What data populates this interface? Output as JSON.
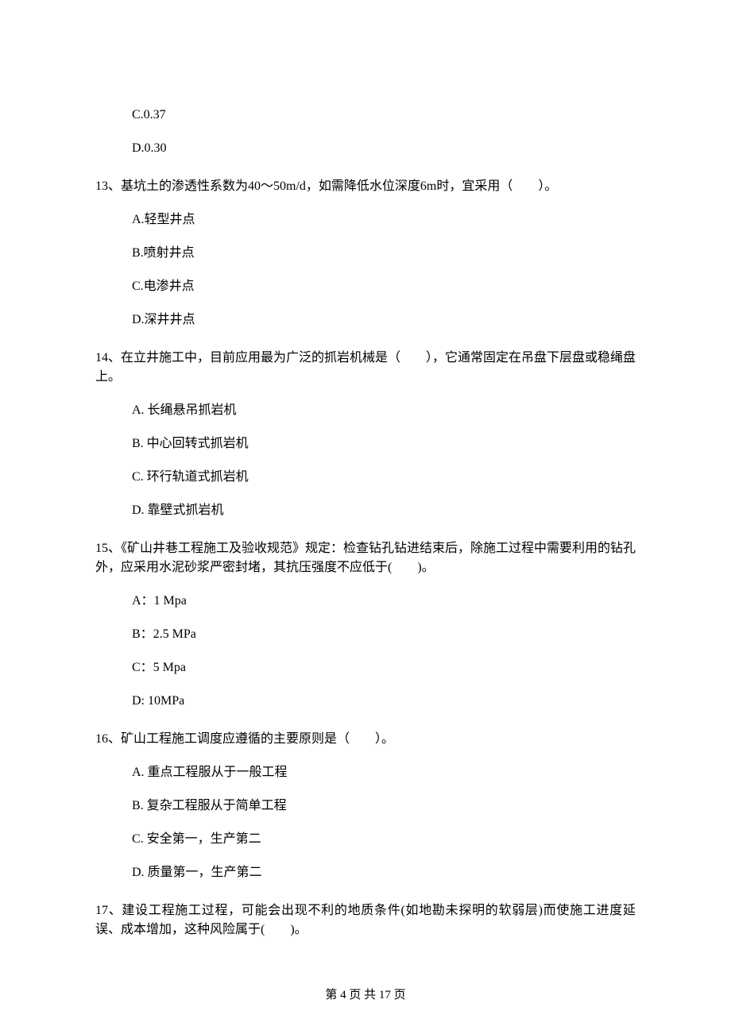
{
  "q12": {
    "optC": "C.0.37",
    "optD": "D.0.30"
  },
  "q13": {
    "stem": "13、基坑土的渗透性系数为40～50m/d，如需降低水位深度6m时，宜采用（　　）。",
    "optA": "A.轻型井点",
    "optB": "B.喷射井点",
    "optC": "C.电渗井点",
    "optD": "D.深井井点"
  },
  "q14": {
    "stem": "14、在立井施工中，目前应用最为广泛的抓岩机械是（　　），它通常固定在吊盘下层盘或稳绳盘上。",
    "optA": "A. 长绳悬吊抓岩机",
    "optB": "B. 中心回转式抓岩机",
    "optC": "C. 环行轨道式抓岩机",
    "optD": "D. 靠壁式抓岩机"
  },
  "q15": {
    "stem": "15、《矿山井巷工程施工及验收规范》规定：检查钻孔钻进结束后，除施工过程中需要利用的钻孔外，应采用水泥砂浆严密封堵，其抗压强度不应低于(　　)。",
    "optA": "A：1 Mpa",
    "optB": "B：2.5 MPa",
    "optC": "C：5 Mpa",
    "optD": "D: 10MPa"
  },
  "q16": {
    "stem": "16、矿山工程施工调度应遵循的主要原则是（　　）。",
    "optA": "A. 重点工程服从于一般工程",
    "optB": "B. 复杂工程服从于简单工程",
    "optC": "C. 安全第一，生产第二",
    "optD": "D. 质量第一，生产第二"
  },
  "q17": {
    "stem": "17、建设工程施工过程，可能会出现不利的地质条件(如地勘未探明的软弱层)而使施工进度延误、成本增加，这种风险属于(　　)。"
  },
  "footer": "第 4 页 共 17 页"
}
